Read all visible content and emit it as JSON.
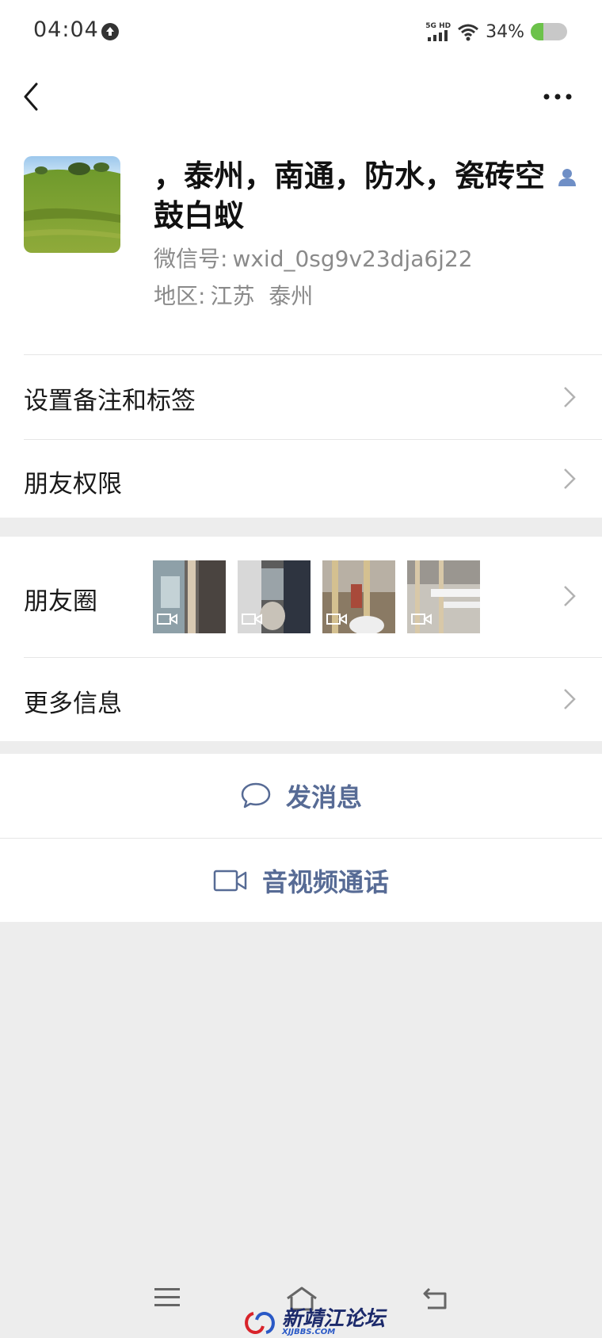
{
  "status_bar": {
    "time": "04:04",
    "network_top": "5G HD",
    "battery_percent": "34%",
    "battery_level": 0.34
  },
  "nav": {
    "back_icon": "chevron-left-icon",
    "more_icon": "ellipsis-icon"
  },
  "profile": {
    "nickname": "，泰州，南通，防水，瓷砖空鼓白蚁",
    "wechat_id_label": "微信号:",
    "wechat_id": "wxid_0sg9v23dja6j22",
    "region_label": "地区:",
    "region": "江苏  泰州"
  },
  "rows": {
    "remarks": "设置备注和标签",
    "permissions": "朋友权限",
    "moments": "朋友圈",
    "more_info": "更多信息"
  },
  "actions": {
    "send_message": "发消息",
    "video_call": "音视频通话"
  },
  "watermark": {
    "name": "新靖江论坛",
    "domain": "XJJBBS.COM"
  },
  "colors": {
    "link_blue": "#576b95",
    "background": "#ededed",
    "battery_green": "#6cc24a"
  }
}
